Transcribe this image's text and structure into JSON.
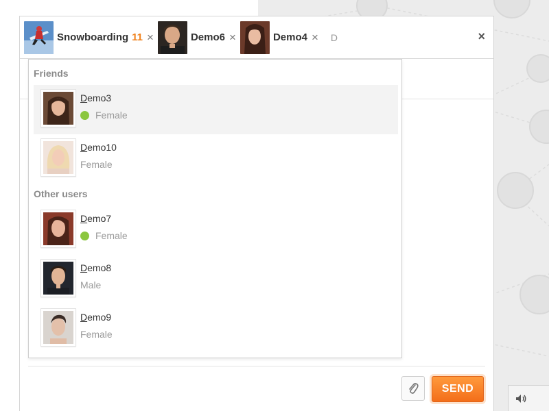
{
  "recipients": [
    {
      "label": "Snowboarding",
      "count": "11",
      "avatar_icon": "snowboarder-icon"
    },
    {
      "label": "Demo6",
      "count": "",
      "avatar_icon": "man-portrait-icon"
    },
    {
      "label": "Demo4",
      "count": "",
      "avatar_icon": "woman-portrait-icon"
    }
  ],
  "remove_glyph": "×",
  "search": {
    "value": "D",
    "placeholder": ""
  },
  "close_glyph": "×",
  "dropdown": {
    "friends_title": "Friends",
    "other_title": "Other users",
    "friends": [
      {
        "name": "Demo3",
        "gender": "Female",
        "online": true
      },
      {
        "name": "Demo10",
        "gender": "Female",
        "online": false
      }
    ],
    "others": [
      {
        "name": "Demo7",
        "gender": "Female",
        "online": true
      },
      {
        "name": "Demo8",
        "gender": "Male",
        "online": false
      },
      {
        "name": "Demo9",
        "gender": "Female",
        "online": false
      }
    ]
  },
  "actions": {
    "attach_icon": "paperclip-icon",
    "send_label": "SEND"
  },
  "volume_icon": "speaker-icon",
  "colors": {
    "accent": "#f36e1a",
    "count": "#f0821e",
    "online": "#8bc63f"
  }
}
